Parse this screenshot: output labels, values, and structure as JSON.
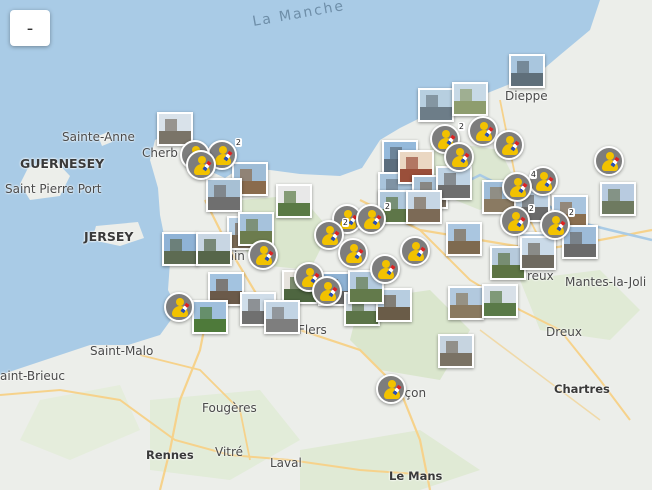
{
  "map": {
    "controls": {
      "zoom_out_label": "-"
    },
    "labels": [
      {
        "id": "la-manche",
        "text": "La Manche",
        "kind": "sea"
      },
      {
        "id": "guernesey",
        "text": "GUERNESEY",
        "kind": "island"
      },
      {
        "id": "saint-pierre-port",
        "text": "Saint Pierre Port",
        "kind": "town"
      },
      {
        "id": "sainte-anne",
        "text": "Sainte-Anne",
        "kind": "town"
      },
      {
        "id": "cherbourg",
        "text": "Cherb",
        "kind": "town"
      },
      {
        "id": "jersey",
        "text": "JERSEY",
        "kind": "island"
      },
      {
        "id": "saint-lo",
        "text": "Sain",
        "kind": "town"
      },
      {
        "id": "saint-malo",
        "text": "Saint-Malo",
        "kind": "town"
      },
      {
        "id": "saint-brieuc",
        "text": "aint-Brieuc",
        "kind": "town"
      },
      {
        "id": "flers",
        "text": "Flers",
        "kind": "town"
      },
      {
        "id": "fougeres",
        "text": "Fougères",
        "kind": "town"
      },
      {
        "id": "vitre",
        "text": "Vitré",
        "kind": "town"
      },
      {
        "id": "rennes",
        "text": "Rennes",
        "kind": "city"
      },
      {
        "id": "laval",
        "text": "Laval",
        "kind": "town"
      },
      {
        "id": "le-mans",
        "text": "Le Mans",
        "kind": "city"
      },
      {
        "id": "alencon",
        "text": "Alençon",
        "kind": "town"
      },
      {
        "id": "dieppe",
        "text": "Dieppe",
        "kind": "town"
      },
      {
        "id": "evreux",
        "text": "reux",
        "kind": "town"
      },
      {
        "id": "mantes",
        "text": "Mantes-la-Joli",
        "kind": "town"
      },
      {
        "id": "dreux",
        "text": "Dreux",
        "kind": "town"
      },
      {
        "id": "chartres",
        "text": "Chartres",
        "kind": "city"
      }
    ],
    "photo_markers": [
      {
        "id": "p1",
        "sky": "#a9c6de",
        "ground": "#5f6f7a"
      },
      {
        "id": "p2",
        "sky": "#b7cfe0",
        "ground": "#6d7d88"
      },
      {
        "id": "p3",
        "sky": "#c7d9e6",
        "ground": "#8e9d6e"
      },
      {
        "id": "p4",
        "sky": "#d9e2ea",
        "ground": "#7a7468"
      },
      {
        "id": "p5",
        "sky": "#9ebcd6",
        "ground": "#8a6b4d"
      },
      {
        "id": "p6",
        "sky": "#a7c0d4",
        "ground": "#6f6f6f"
      },
      {
        "id": "p7",
        "sky": "#e8e8e8",
        "ground": "#5a7a45"
      },
      {
        "id": "p8",
        "sky": "#b9d1e6",
        "ground": "#7b6a55"
      },
      {
        "id": "p9",
        "sky": "#8fb3d6",
        "ground": "#5d6b52"
      },
      {
        "id": "p10",
        "sky": "#c8d6e3",
        "ground": "#56664a"
      },
      {
        "id": "p11",
        "sky": "#a3c3e0",
        "ground": "#6b5a4a"
      },
      {
        "id": "p12",
        "sky": "#cfdde9",
        "ground": "#707070"
      },
      {
        "id": "p13",
        "sky": "#9fbfdc",
        "ground": "#4e7a3a"
      },
      {
        "id": "p14",
        "sky": "#e6e3dd",
        "ground": "#4e6640"
      },
      {
        "id": "p15",
        "sky": "#8eb2d4",
        "ground": "#6c6c6c"
      },
      {
        "id": "p16",
        "sky": "#cfd9e2",
        "ground": "#5c7448"
      },
      {
        "id": "p17",
        "sky": "#b7cde0",
        "ground": "#6a5c48"
      },
      {
        "id": "p18",
        "sky": "#94b9db",
        "ground": "#5c6e7e"
      },
      {
        "id": "p19",
        "sky": "#a8c4dc",
        "ground": "#6e7f8c"
      },
      {
        "id": "p20",
        "sky": "#ead7c2",
        "ground": "#9a4f3a"
      },
      {
        "id": "p21",
        "sky": "#a9c3d8",
        "ground": "#7a6e60"
      },
      {
        "id": "p22",
        "sky": "#bfd3e4",
        "ground": "#6e6e6e"
      },
      {
        "id": "p23",
        "sky": "#b0c8dc",
        "ground": "#5e7648"
      },
      {
        "id": "p24",
        "sky": "#c6d6e4",
        "ground": "#7c6a56"
      },
      {
        "id": "p25",
        "sky": "#9ebcd8",
        "ground": "#8a7a62"
      },
      {
        "id": "p26",
        "sky": "#bcd0e2",
        "ground": "#6a6a6a"
      },
      {
        "id": "p27",
        "sky": "#a8c4de",
        "ground": "#8a6f50"
      },
      {
        "id": "p28",
        "sky": "#b8cbe0",
        "ground": "#6e7a60"
      },
      {
        "id": "p29",
        "sky": "#aac6e0",
        "ground": "#7e6a50"
      },
      {
        "id": "p30",
        "sky": "#c0d4e6",
        "ground": "#66785a"
      },
      {
        "id": "p31",
        "sky": "#9dbbd8",
        "ground": "#6b6b6b"
      },
      {
        "id": "p32",
        "sky": "#b6cadc",
        "ground": "#5d7444"
      },
      {
        "id": "p33",
        "sky": "#cadae8",
        "ground": "#6f6a60"
      },
      {
        "id": "p34",
        "sky": "#b2c9de",
        "ground": "#8a7a60"
      },
      {
        "id": "p35",
        "sky": "#d8e0e8",
        "ground": "#5a7a48"
      },
      {
        "id": "p36",
        "sky": "#c6d4e0",
        "ground": "#7a7264"
      },
      {
        "id": "p37",
        "sky": "#a6c2dc",
        "ground": "#6c7c4e"
      },
      {
        "id": "p38",
        "sky": "#c2d4e4",
        "ground": "#7e7e7e"
      },
      {
        "id": "p39",
        "sky": "#b4cadf",
        "ground": "#637a4b"
      }
    ],
    "person_markers": [
      {
        "id": "m1",
        "count": "2"
      },
      {
        "id": "m2",
        "count": ""
      },
      {
        "id": "m3",
        "count": ""
      },
      {
        "id": "m4",
        "count": "2"
      },
      {
        "id": "m5",
        "count": ""
      },
      {
        "id": "m6",
        "count": ""
      },
      {
        "id": "m7",
        "count": ""
      },
      {
        "id": "m8",
        "count": ""
      },
      {
        "id": "m9",
        "count": ""
      },
      {
        "id": "m10",
        "count": "4"
      },
      {
        "id": "m11",
        "count": ""
      },
      {
        "id": "m12",
        "count": "2"
      },
      {
        "id": "m13",
        "count": "2"
      },
      {
        "id": "m14",
        "count": ""
      },
      {
        "id": "m15",
        "count": ""
      },
      {
        "id": "m16",
        "count": ""
      },
      {
        "id": "m17",
        "count": ""
      },
      {
        "id": "m18",
        "count": ""
      },
      {
        "id": "m19",
        "count": ""
      },
      {
        "id": "m20",
        "count": ""
      },
      {
        "id": "m21",
        "count": "2"
      },
      {
        "id": "m22",
        "count": ""
      },
      {
        "id": "m23",
        "count": "2"
      }
    ],
    "colors": {
      "sea": "#a9cbe6",
      "land": "#eceeea",
      "forest": "#cfe0bd",
      "road": "#f6d28b"
    }
  }
}
